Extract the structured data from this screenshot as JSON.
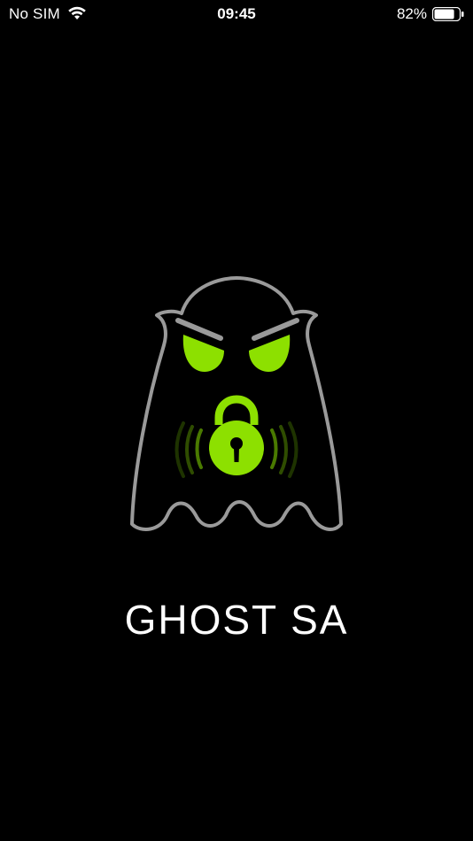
{
  "status_bar": {
    "carrier": "No SIM",
    "time": "09:45",
    "battery_percent": "82%",
    "battery_level": 0.82,
    "icons": [
      "wifi-icon",
      "battery-icon"
    ]
  },
  "splash": {
    "app_name": "GHOST SA",
    "logo_icon": "ghost-lock-icon"
  },
  "colors": {
    "background": "#000000",
    "accent": "#8de000",
    "outline": "#9a9a9a",
    "text": "#ffffff"
  }
}
